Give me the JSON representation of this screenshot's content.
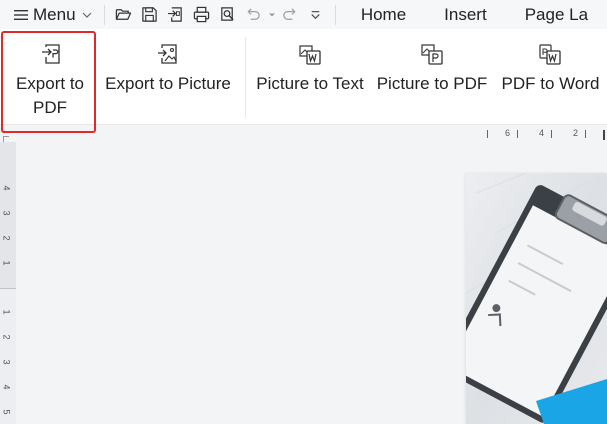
{
  "menubar": {
    "menu_label": "Menu",
    "quick_access": [
      {
        "icon": "folder-open-icon"
      },
      {
        "icon": "save-icon"
      },
      {
        "icon": "export-icon"
      },
      {
        "icon": "print-icon"
      },
      {
        "icon": "print-preview-icon"
      },
      {
        "icon": "undo-icon"
      },
      {
        "icon": "redo-icon"
      },
      {
        "icon": "customize-dropdown-icon"
      }
    ],
    "tabs": [
      "Home",
      "Insert",
      "Page La"
    ]
  },
  "ribbon": {
    "buttons": [
      {
        "line1": "Export to",
        "line2": "PDF",
        "icon": "export-pdf-icon",
        "highlighted": true
      },
      {
        "line1": "Export to Picture",
        "icon": "export-picture-icon"
      },
      {
        "line1": "Picture to Text",
        "icon": "picture-to-text-icon"
      },
      {
        "line1": "Picture to PDF",
        "icon": "picture-to-pdf-icon"
      },
      {
        "line1": "PDF to Word",
        "icon": "pdf-to-word-icon"
      }
    ]
  },
  "ruler": {
    "horizontal": [
      "6",
      "4",
      "2"
    ],
    "vertical": [
      "4",
      "3",
      "2",
      "1",
      "1",
      "2",
      "3",
      "4",
      "5"
    ]
  },
  "colors": {
    "highlight": "#e02a2a",
    "ribbon_bg": "#ffffff",
    "menubar_bg": "#f6f7f9",
    "canvas_bg": "#f3f4f6",
    "accent": "#1aa5e6"
  }
}
